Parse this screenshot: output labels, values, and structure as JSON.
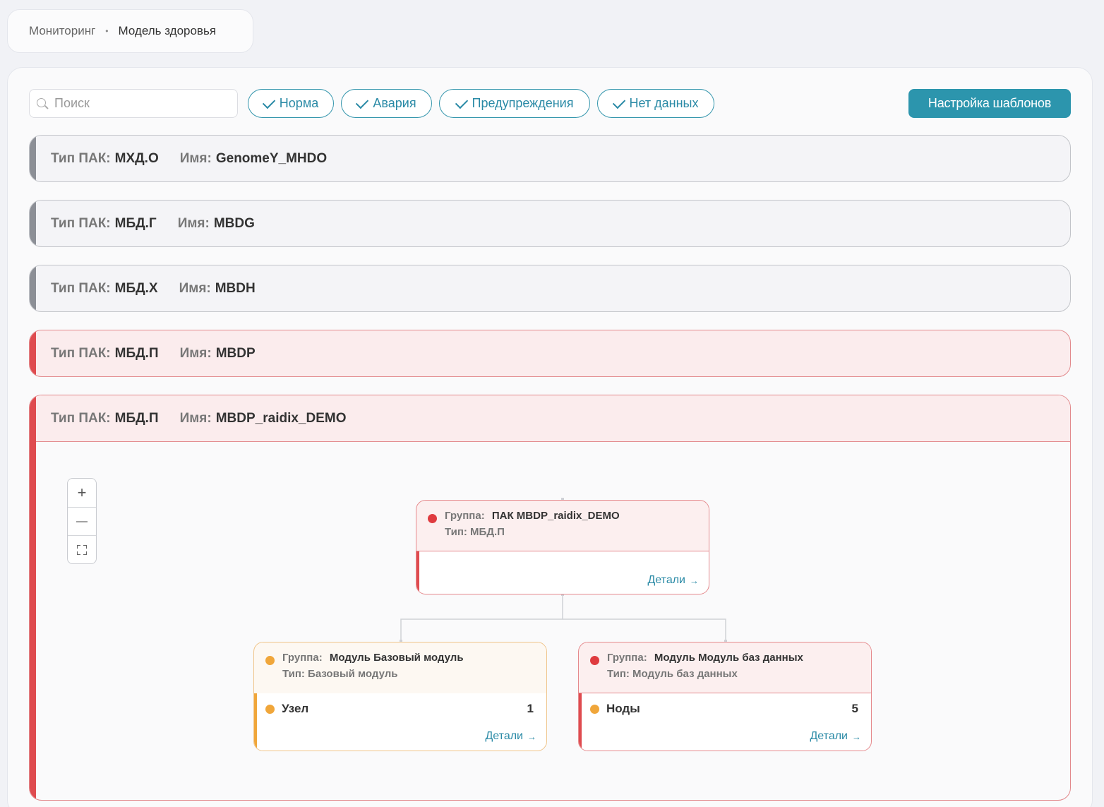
{
  "breadcrumb": {
    "items": [
      "Мониторинг",
      "Модель здоровья"
    ],
    "separator": "•"
  },
  "toolbar": {
    "search": {
      "placeholder": "Поиск",
      "value": ""
    },
    "filters": [
      {
        "label": "Норма",
        "checked": true
      },
      {
        "label": "Авария",
        "checked": true
      },
      {
        "label": "Предупреждения",
        "checked": true
      },
      {
        "label": "Нет данных",
        "checked": true
      }
    ],
    "settings_label": "Настройка шаблонов"
  },
  "labels": {
    "type": "Тип ПАК:",
    "name": "Имя:"
  },
  "devices": [
    {
      "type": "МХД.О",
      "name": "GenomeY_MHDO",
      "status": "no-data"
    },
    {
      "type": "МБД.Г",
      "name": "MBDG",
      "status": "no-data"
    },
    {
      "type": "МБД.Х",
      "name": "MBDH",
      "status": "no-data"
    },
    {
      "type": "МБД.П",
      "name": "MBDP",
      "status": "alarm"
    },
    {
      "type": "МБД.П",
      "name": "MBDP_raidix_DEMO",
      "status": "alarm",
      "expanded": true
    }
  ],
  "zoom_controls": {
    "zoom_in": "+",
    "zoom_out": "—"
  },
  "graph": {
    "root": {
      "group_label": "Группа:",
      "group_value": "ПАК MBDP_raidix_DEMO",
      "type_label": "Тип:",
      "type_value": "МБД.П",
      "status": "alarm",
      "details": "Детали",
      "arrow": "→"
    },
    "children": [
      {
        "group_label": "Группа:",
        "group_value": "Модуль Базовый модуль",
        "type_label": "Тип:",
        "type_value": "Базовый модуль",
        "status": "warning",
        "metric_name": "Узел",
        "metric_value": "1",
        "details": "Детали",
        "arrow": "→"
      },
      {
        "group_label": "Группа:",
        "group_value": "Модуль Модуль баз данных",
        "type_label": "Тип:",
        "type_value": "Модуль баз данных",
        "status": "alarm",
        "metric_name": "Ноды",
        "metric_value": "5",
        "details": "Детали",
        "arrow": "→"
      }
    ]
  },
  "colors": {
    "accent": "#2c95ad",
    "alarm": "#df4b4f",
    "warning": "#f0a63a",
    "no_data": "#8c8f96"
  }
}
